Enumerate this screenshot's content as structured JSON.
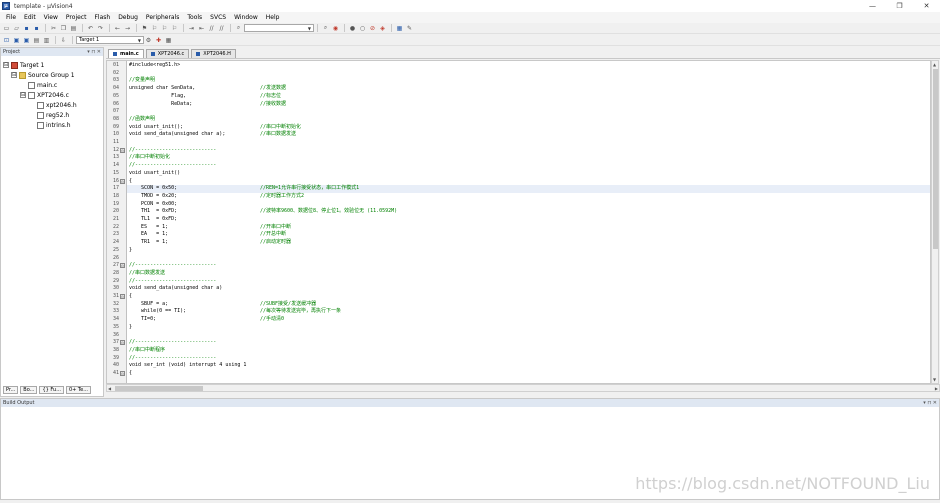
{
  "window": {
    "title": "template - µVision4",
    "controls": [
      "—",
      "❐",
      "✕"
    ]
  },
  "menu": [
    "File",
    "Edit",
    "View",
    "Project",
    "Flash",
    "Debug",
    "Peripherals",
    "Tools",
    "SVCS",
    "Window",
    "Help"
  ],
  "toolbar": {
    "target_combo": "Target 1"
  },
  "project": {
    "title": "Project",
    "controls": "▾ ⊓ ✕",
    "tree": [
      {
        "label": "Target 1",
        "level": 0,
        "icon": "target",
        "expander": "⊟"
      },
      {
        "label": "Source Group 1",
        "level": 1,
        "icon": "folder",
        "expander": "⊟"
      },
      {
        "label": "main.c",
        "level": 2,
        "icon": "file",
        "expander": ""
      },
      {
        "label": "XPT2046.c",
        "level": 2,
        "icon": "file",
        "expander": "⊟"
      },
      {
        "label": "xpt2046.h",
        "level": 3,
        "icon": "file",
        "expander": ""
      },
      {
        "label": "reg52.h",
        "level": 3,
        "icon": "file",
        "expander": ""
      },
      {
        "label": "intrins.h",
        "level": 3,
        "icon": "file",
        "expander": ""
      }
    ],
    "bottom_tabs": [
      "Pr...",
      "Bo...",
      "{} Fu...",
      "0+ Te..."
    ]
  },
  "editor": {
    "tabs": [
      {
        "label": "main.c",
        "active": true
      },
      {
        "label": "XPT2046.c",
        "active": false
      },
      {
        "label": "XPT2046.H",
        "active": false
      }
    ],
    "lines": [
      {
        "n": "01",
        "code": "#include<reg51.h>",
        "comment": "",
        "fold": ""
      },
      {
        "n": "02",
        "code": "",
        "comment": "",
        "fold": ""
      },
      {
        "n": "03",
        "code": "//变量声明",
        "comment": "",
        "fold": ""
      },
      {
        "n": "04",
        "code": "unsigned char SenData,",
        "comment": "//发送数据",
        "fold": ""
      },
      {
        "n": "05",
        "code": "              Flag,",
        "comment": "//标志位",
        "fold": ""
      },
      {
        "n": "06",
        "code": "              ReData;",
        "comment": "//接收数据",
        "fold": ""
      },
      {
        "n": "07",
        "code": "",
        "comment": "",
        "fold": ""
      },
      {
        "n": "08",
        "code": "//函数声明",
        "comment": "",
        "fold": ""
      },
      {
        "n": "09",
        "code": "void usart_init();",
        "comment": "//串口中断初始化",
        "fold": ""
      },
      {
        "n": "10",
        "code": "void send_data(unsigned char a);",
        "comment": "//串口数据发送",
        "fold": ""
      },
      {
        "n": "11",
        "code": "",
        "comment": "",
        "fold": ""
      },
      {
        "n": "12",
        "code": "//---------------------------",
        "comment": "",
        "fold": "⊟"
      },
      {
        "n": "13",
        "code": "//串口中断初始化",
        "comment": "",
        "fold": ""
      },
      {
        "n": "14",
        "code": "//---------------------------",
        "comment": "",
        "fold": ""
      },
      {
        "n": "15",
        "code": "void usart_init()",
        "comment": "",
        "fold": ""
      },
      {
        "n": "16",
        "code": "{",
        "comment": "",
        "fold": "⊟"
      },
      {
        "n": "17",
        "code": "    SCON = 0x50;",
        "comment": "//REN=1允许串行接受状态，串口工作模式1",
        "fold": ""
      },
      {
        "n": "18",
        "code": "    TMOD = 0x20;",
        "comment": "//定时器工作方式2",
        "fold": ""
      },
      {
        "n": "19",
        "code": "    PCON = 0x00;",
        "comment": "",
        "fold": ""
      },
      {
        "n": "20",
        "code": "    TH1  = 0xFD;",
        "comment": "//波特率9600、数据位8、停止位1。效验位无 (11.0592M)",
        "fold": ""
      },
      {
        "n": "21",
        "code": "    TL1  = 0xFD;",
        "comment": "",
        "fold": ""
      },
      {
        "n": "22",
        "code": "    ES   = 1;",
        "comment": "//开串口中断",
        "fold": ""
      },
      {
        "n": "23",
        "code": "    EA   = 1;",
        "comment": "//开总中断",
        "fold": ""
      },
      {
        "n": "24",
        "code": "    TR1  = 1;",
        "comment": "//启动定时器",
        "fold": ""
      },
      {
        "n": "25",
        "code": "}",
        "comment": "",
        "fold": ""
      },
      {
        "n": "26",
        "code": "",
        "comment": "",
        "fold": ""
      },
      {
        "n": "27",
        "code": "//---------------------------",
        "comment": "",
        "fold": "⊟"
      },
      {
        "n": "28",
        "code": "//串口数据发送",
        "comment": "",
        "fold": ""
      },
      {
        "n": "29",
        "code": "//---------------------------",
        "comment": "",
        "fold": ""
      },
      {
        "n": "30",
        "code": "void send_data(unsigned char a)",
        "comment": "",
        "fold": ""
      },
      {
        "n": "31",
        "code": "{",
        "comment": "",
        "fold": "⊟"
      },
      {
        "n": "32",
        "code": "    SBUF = a;",
        "comment": "//SUBF接受/发送缓冲器",
        "fold": ""
      },
      {
        "n": "33",
        "code": "    while(0 == TI);",
        "comment": "//每次等待发送完毕，再执行下一条",
        "fold": ""
      },
      {
        "n": "34",
        "code": "    TI=0;",
        "comment": "//手动清0",
        "fold": ""
      },
      {
        "n": "35",
        "code": "}",
        "comment": "",
        "fold": ""
      },
      {
        "n": "36",
        "code": "",
        "comment": "",
        "fold": ""
      },
      {
        "n": "37",
        "code": "//---------------------------",
        "comment": "",
        "fold": "⊟"
      },
      {
        "n": "38",
        "code": "//串口中断程序",
        "comment": "",
        "fold": ""
      },
      {
        "n": "39",
        "code": "//---------------------------",
        "comment": "",
        "fold": ""
      },
      {
        "n": "40",
        "code": "void ser_int (void) interrupt 4 using 1",
        "comment": "",
        "fold": ""
      },
      {
        "n": "41",
        "code": "{",
        "comment": "",
        "fold": "⊟"
      }
    ]
  },
  "build": {
    "title": "Build Output",
    "controls": "▾ ⊓ ✕"
  },
  "watermark": "https://blog.csdn.net/NOTFOUND_Liu"
}
